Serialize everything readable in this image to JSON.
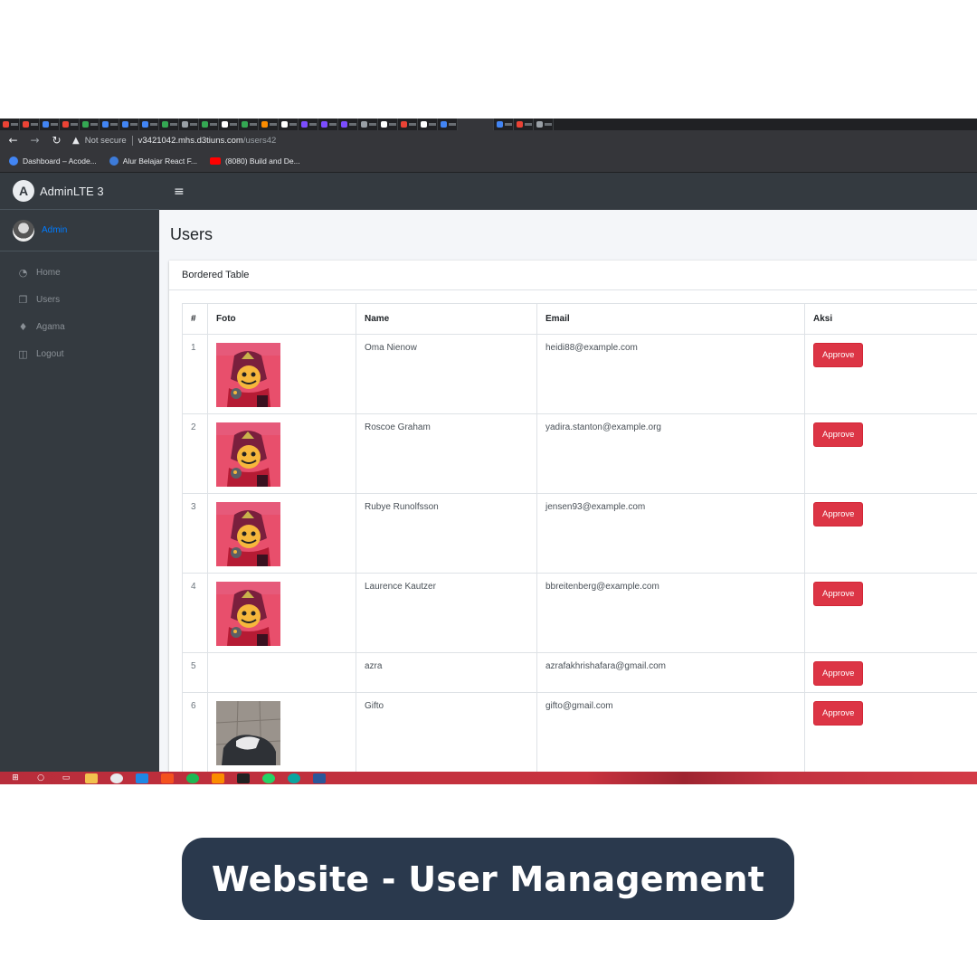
{
  "browser": {
    "security_label": "Not secure",
    "url_host": "v3421042.mhs.d3tiuns.com",
    "url_path": "/users42",
    "bookmarks": [
      {
        "label": "Dashboard – Acode...",
        "color": "#4285f4"
      },
      {
        "label": "Alur Belajar React F...",
        "color": "#3d7bd9"
      },
      {
        "label": "(8080) Build and De...",
        "color": "#ff0000"
      }
    ]
  },
  "sidebar": {
    "brand": "AdminLTE 3",
    "brand_logo": "A",
    "user": "Admin",
    "items": [
      {
        "label": "Home",
        "icon": "dashboard-icon"
      },
      {
        "label": "Users",
        "icon": "copy-icon"
      },
      {
        "label": "Agama",
        "icon": "bell-icon"
      },
      {
        "label": "Logout",
        "icon": "columns-icon"
      }
    ]
  },
  "page": {
    "title": "Users",
    "card_title": "Bordered Table"
  },
  "table": {
    "headers": [
      "#",
      "Foto",
      "Name",
      "Email",
      "Aksi"
    ],
    "action_label": "Approve",
    "rows": [
      {
        "num": "1",
        "name": "Oma Nienow",
        "email": "heidi88@example.com",
        "photo": "character-art"
      },
      {
        "num": "2",
        "name": "Roscoe Graham",
        "email": "yadira.stanton@example.org",
        "photo": "character-art"
      },
      {
        "num": "3",
        "name": "Rubye Runolfsson",
        "email": "jensen93@example.com",
        "photo": "character-art"
      },
      {
        "num": "4",
        "name": "Laurence Kautzer",
        "email": "bbreitenberg@example.com",
        "photo": "character-art"
      },
      {
        "num": "5",
        "name": "azra",
        "email": "azrafakhrishafara@gmail.com",
        "photo": "none"
      },
      {
        "num": "6",
        "name": "Gifto",
        "email": "gifto@gmail.com",
        "photo": "floor-photo"
      }
    ]
  },
  "caption": "Website - User Management",
  "colors": {
    "sidebar_bg": "#343a40",
    "approve_button": "#dc3545",
    "caption_bg": "#2a394d",
    "link": "#007bff"
  }
}
